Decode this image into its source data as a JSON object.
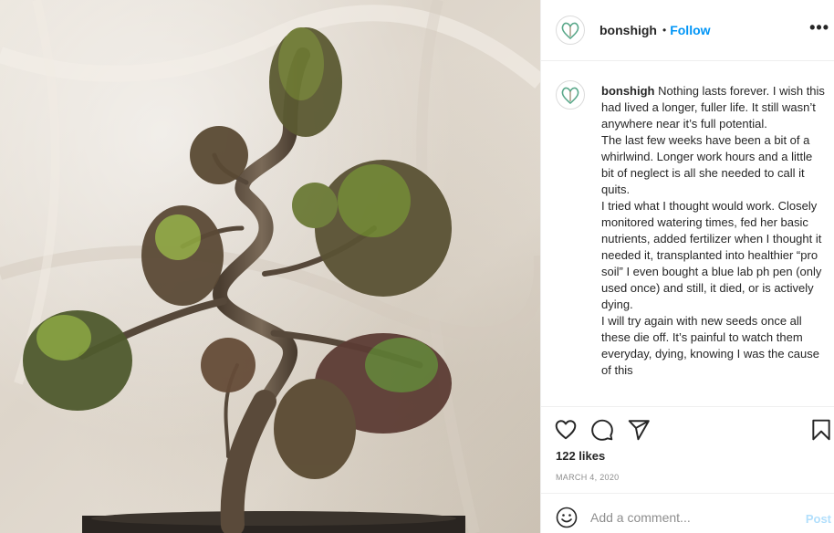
{
  "post": {
    "image_alt": "bonsai",
    "username": "bonshigh",
    "header_dot": "•",
    "follow_label": "Follow",
    "more_label": "•••",
    "caption_user": "bonshigh",
    "caption_text": "Nothing lasts forever. I wish this had lived a longer, fuller life. It still wasn’t anywhere near it’s full potential.\nThe last few weeks have been a bit of a whirlwind. Longer work hours and a little bit of neglect is all she needed to call it quits.\nI tried what I thought would work. Closely monitored watering times, fed her basic nutrients, added fertilizer when I thought it needed it, transplanted into healthier “pro soil” I even bought a blue lab ph pen (only used once) and still, it died, or is actively dying.\nI will try again with new seeds once all these die off. It’s painful to watch them everyday, dying, knowing I was the cause of this",
    "likes": "122 likes",
    "date": "MARCH 4, 2020"
  },
  "icons": {
    "like": "heart-icon",
    "comment": "comment-bubble-icon",
    "share": "paper-plane-icon",
    "save": "bookmark-icon",
    "emoji": "smiley-icon",
    "avatar": "heart-leaf-logo"
  },
  "comment": {
    "placeholder": "Add a comment...",
    "post_label": "Post"
  },
  "colors": {
    "follow": "#0095f6",
    "post_disabled": "#b2dffc",
    "muted": "#8e8e8e",
    "text": "#262626",
    "divider": "#efefef"
  }
}
